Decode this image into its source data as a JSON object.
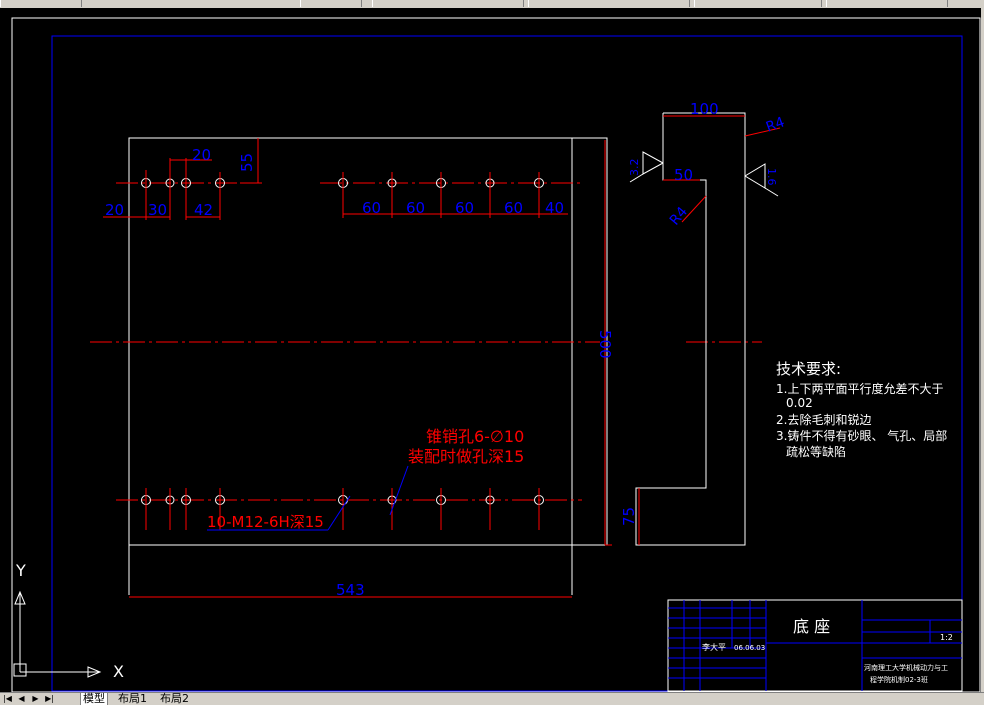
{
  "drawing": {
    "dims": {
      "d100": "100",
      "d20_top": "20",
      "d55": "55",
      "d20_left": "20",
      "d30": "30",
      "d42": "42",
      "d60_1": "60",
      "d60_2": "60",
      "d60_3": "60",
      "d60_4": "60",
      "d40": "40",
      "d500": "500",
      "d543": "543",
      "d50": "50",
      "d75": "75",
      "r4_top": "R4",
      "r4_mid": "R4"
    },
    "roughness": {
      "left": "3.2",
      "right": "1.6"
    },
    "notes": {
      "pin_hole_line1": "锥销孔6-∅10",
      "pin_hole_line2": "装配时做孔深15",
      "thread_hole": "10-M12-6H深15"
    },
    "requirements": {
      "title": "技术要求:",
      "item1_line1": "1.上下两平面平行度允差不大于",
      "item1_line2": "0.02",
      "item2": "2.去除毛刺和锐边",
      "item3_line1": "3.铸件不得有砂眼、 气孔、局部",
      "item3_line2": "疏松等缺陷"
    },
    "title_block": {
      "part_name": "底 座",
      "drawn_by": "李大平",
      "date": "06.06.03",
      "scale": "1:2",
      "school_line1": "河南理工大学机械动力与工",
      "school_line2": "程学院机制02-3班"
    },
    "ucs": {
      "x_label": "X",
      "y_label": "Y"
    }
  },
  "tabs": {
    "model": "模型",
    "layout1": "布局1",
    "layout2": "布局2"
  },
  "colors": {
    "background": "#000000",
    "geometry": "#ffffff",
    "dimension": "#ff0000",
    "dim_text": "#0000ff",
    "frame": "#0000ff"
  }
}
